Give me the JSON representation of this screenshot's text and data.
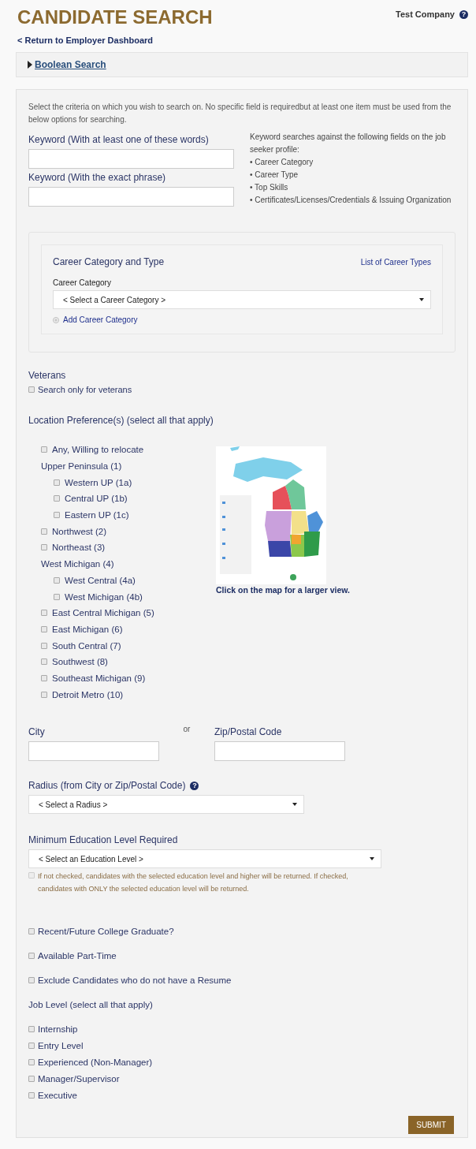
{
  "header": {
    "title": "CANDIDATE SEARCH",
    "company": "Test Company",
    "help": "?",
    "back_link": "< Return to Employer Dashboard"
  },
  "boolean_search": {
    "label": "Boolean Search",
    "expanded": false
  },
  "intro": "Select the criteria on which you wish to search on. No specific field is requiredbut at least one item must be used from the below options for searching.",
  "keywords": [
    {
      "label": "Keyword (With at least one of these words)"
    },
    {
      "label": "Keyword (With the exact phrase)"
    }
  ],
  "keyword_help": {
    "text": "Keyword searches against the following fields on the job seeker profile:",
    "fields": [
      "• Career Category",
      "• Career Type",
      "• Top Skills",
      "• Certificates/Licenses/Credentials & Issuing Organization"
    ]
  },
  "career": {
    "title": "Career Category and Type",
    "link": "List of Career Types",
    "field_label": "Career Category",
    "select": "< Select a Career Category >",
    "add_link": "Add Career Category"
  },
  "veterans": {
    "title": "Veterans",
    "label": "Search only for veterans",
    "checked": false
  },
  "location": {
    "title": "Location Preference(s) (select all that apply)",
    "map_caption": "Click on the map for a larger view.",
    "items": [
      {
        "kind": "option",
        "label": "Any, Willing to relocate",
        "checked": false
      },
      {
        "kind": "group",
        "label": "Upper Peninsula (1)",
        "children": [
          {
            "kind": "option",
            "label": "Western UP (1a)",
            "checked": false
          },
          {
            "kind": "option",
            "label": "Central UP (1b)",
            "checked": false
          },
          {
            "kind": "option",
            "label": "Eastern UP (1c)",
            "checked": false
          }
        ]
      },
      {
        "kind": "option",
        "label": "Northwest (2)",
        "checked": false
      },
      {
        "kind": "option",
        "label": "Northeast (3)",
        "checked": false
      },
      {
        "kind": "group",
        "label": "West Michigan (4)",
        "children": [
          {
            "kind": "option",
            "label": "West Central (4a)",
            "checked": false
          },
          {
            "kind": "option",
            "label": "West Michigan (4b)",
            "checked": false
          }
        ]
      },
      {
        "kind": "option",
        "label": "East Central Michigan (5)",
        "checked": false
      },
      {
        "kind": "option",
        "label": "East Michigan (6)",
        "checked": false
      },
      {
        "kind": "option",
        "label": "South Central (7)",
        "checked": false
      },
      {
        "kind": "option",
        "label": "Southwest (8)",
        "checked": false
      },
      {
        "kind": "option",
        "label": "Southeast Michigan (9)",
        "checked": false
      },
      {
        "kind": "option",
        "label": "Detroit Metro (10)",
        "checked": false
      }
    ]
  },
  "city": {
    "label": "City"
  },
  "or": "or",
  "zip": {
    "label": "Zip/Postal Code"
  },
  "radius": {
    "label": "Radius (from City or Zip/Postal Code)",
    "help": "?",
    "select": "< Select a Radius >"
  },
  "education": {
    "label": "Minimum Education Level Required",
    "select": "< Select an Education Level >",
    "only": {
      "label": "If not checked, candidates with the selected education level and higher will be returned. If checked, candidates with ONLY the selected education level will be returned.",
      "checked": false,
      "disabled": true
    }
  },
  "options": [
    {
      "label": "Recent/Future College Graduate?",
      "checked": false
    },
    {
      "label": "Available Part-Time",
      "checked": false
    },
    {
      "label": "Exclude Candidates who do not have a Resume",
      "checked": false
    }
  ],
  "job_level": {
    "title": "Job Level (select all that apply)",
    "items": [
      {
        "label": "Internship",
        "checked": false
      },
      {
        "label": "Entry Level",
        "checked": false
      },
      {
        "label": "Experienced (Non-Manager)",
        "checked": false
      },
      {
        "label": "Manager/Supervisor",
        "checked": false
      },
      {
        "label": "Executive",
        "checked": false
      }
    ]
  },
  "submit": "SUBMIT"
}
